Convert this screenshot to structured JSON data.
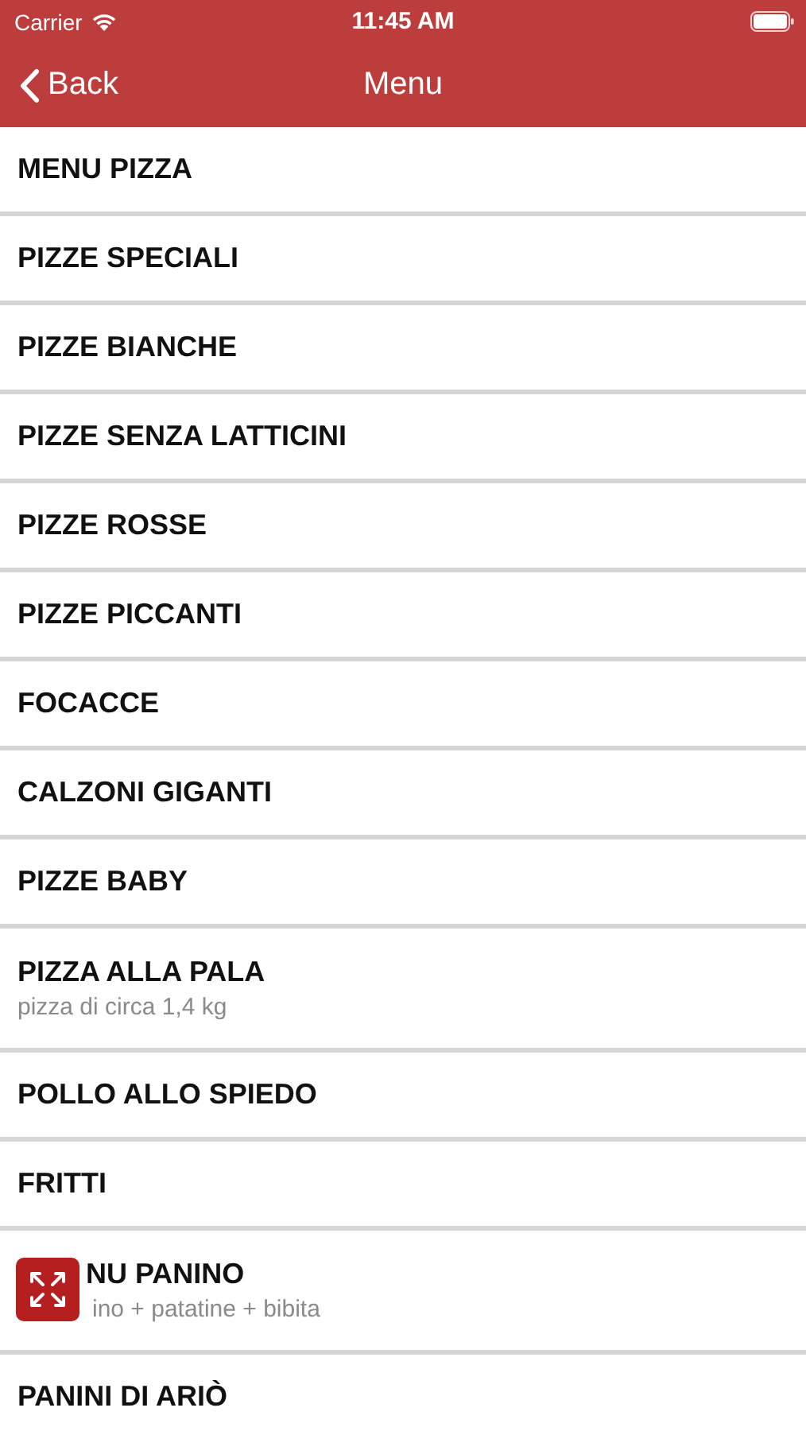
{
  "status_bar": {
    "carrier": "Carrier",
    "time": "11:45 AM"
  },
  "nav_bar": {
    "back": "Back",
    "title": "Menu"
  },
  "items": [
    {
      "title": "MENU PIZZA"
    },
    {
      "title": "PIZZE SPECIALI"
    },
    {
      "title": "PIZZE BIANCHE"
    },
    {
      "title": "PIZZE SENZA LATTICINI"
    },
    {
      "title": "PIZZE ROSSE"
    },
    {
      "title": "PIZZE PICCANTI"
    },
    {
      "title": "FOCACCE"
    },
    {
      "title": "CALZONI GIGANTI"
    },
    {
      "title": "PIZZE BABY"
    },
    {
      "title": "PIZZA ALLA PALA",
      "subtitle": "pizza di circa 1,4 kg"
    },
    {
      "title": "POLLO ALLO SPIEDO"
    },
    {
      "title": "FRITTI"
    },
    {
      "title": "NU PANINO",
      "subtitle": "ino + patatine + bibita",
      "covered": true
    },
    {
      "title": "PANINI DI ARIÒ"
    }
  ]
}
